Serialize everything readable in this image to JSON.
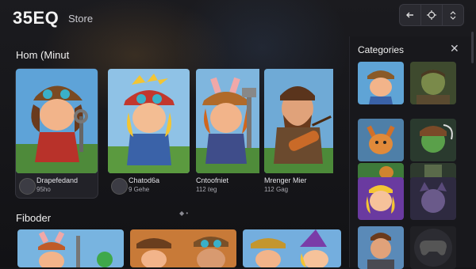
{
  "brand": {
    "logo": "35EQ",
    "store": "Store"
  },
  "toolbar": {
    "icons": [
      "back-arrow-icon",
      "target-icon",
      "chevron-icon"
    ]
  },
  "featured": {
    "title": "Hom (Minut",
    "cards": [
      {
        "name": "Drapefedand",
        "sub": "95ho"
      },
      {
        "name": "Chatod6a",
        "sub": "9 Gehe"
      },
      {
        "name": "Cntoofniet",
        "sub": "112 ℓeg"
      },
      {
        "name": "Mrenger Mier",
        "sub": "112 Gag"
      }
    ]
  },
  "second": {
    "title": "Fiboder"
  },
  "pager": {
    "dots": "◆ •"
  },
  "categories": {
    "title": "Categories",
    "close": "✕"
  },
  "colors": {
    "bg": "#141417",
    "panel": "#18181c",
    "accent": "#2f7fd0"
  }
}
